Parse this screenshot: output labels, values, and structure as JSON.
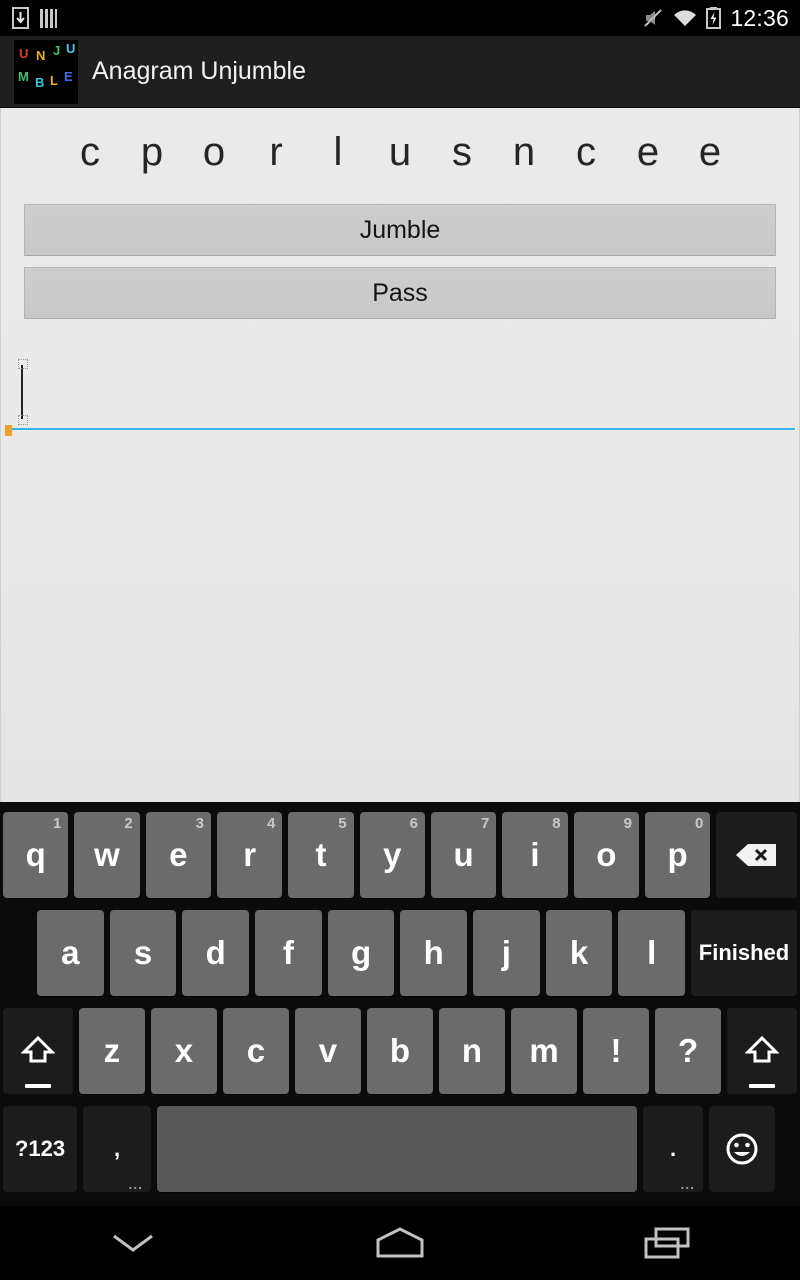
{
  "status_bar": {
    "icons_left": [
      "download-icon",
      "bars-icon"
    ],
    "icons_right": [
      "mute-icon",
      "wifi-icon",
      "battery-charging-icon"
    ],
    "time": "12:36"
  },
  "action_bar": {
    "title": "Anagram Unjumble",
    "logo_alt": "unjumble-app-icon",
    "logo_letters": [
      {
        "char": "U",
        "color": "#e03b2f"
      },
      {
        "char": "N",
        "color": "#f0b01c"
      },
      {
        "char": "J",
        "color": "#3fc36b"
      },
      {
        "char": "U",
        "color": "#4ec8e8"
      },
      {
        "char": "M",
        "color": "#3fc36b"
      },
      {
        "char": "B",
        "color": "#30c7d8"
      },
      {
        "char": "L",
        "color": "#f0b01c"
      },
      {
        "char": "E",
        "color": "#3b6df0"
      }
    ]
  },
  "main": {
    "letters": [
      "c",
      "p",
      "o",
      "r",
      "l",
      "u",
      "s",
      "n",
      "c",
      "e",
      "e"
    ],
    "jumble_button": "Jumble",
    "pass_button": "Pass",
    "answer_input": {
      "value": "",
      "placeholder": ""
    }
  },
  "keyboard": {
    "row1": [
      {
        "label": "q",
        "num": "1"
      },
      {
        "label": "w",
        "num": "2"
      },
      {
        "label": "e",
        "num": "3"
      },
      {
        "label": "r",
        "num": "4"
      },
      {
        "label": "t",
        "num": "5"
      },
      {
        "label": "y",
        "num": "6"
      },
      {
        "label": "u",
        "num": "7"
      },
      {
        "label": "i",
        "num": "8"
      },
      {
        "label": "o",
        "num": "9"
      },
      {
        "label": "p",
        "num": "0"
      }
    ],
    "backspace": "backspace-icon",
    "row2": [
      "a",
      "s",
      "d",
      "f",
      "g",
      "h",
      "j",
      "k",
      "l"
    ],
    "finished_key": "Finished",
    "row3": [
      "z",
      "x",
      "c",
      "v",
      "b",
      "n",
      "m",
      "!",
      "?"
    ],
    "shift_key": "shift-icon",
    "symbols_key": "?123",
    "comma_key": ",",
    "space_key": "",
    "period_key": ".",
    "emoji_key": "emoji-icon",
    "more_dots": "..."
  },
  "nav_bar": {
    "back": "chevron-down-icon",
    "home": "home-icon",
    "recents": "recent-apps-icon"
  },
  "colors": {
    "accent_underline": "#33b5e5",
    "action_bar_bg": "#1f1f1f",
    "content_bg": "#e9e9e9",
    "key_bg": "#6b6b6b",
    "keyboard_bg": "#0b0b0b"
  }
}
